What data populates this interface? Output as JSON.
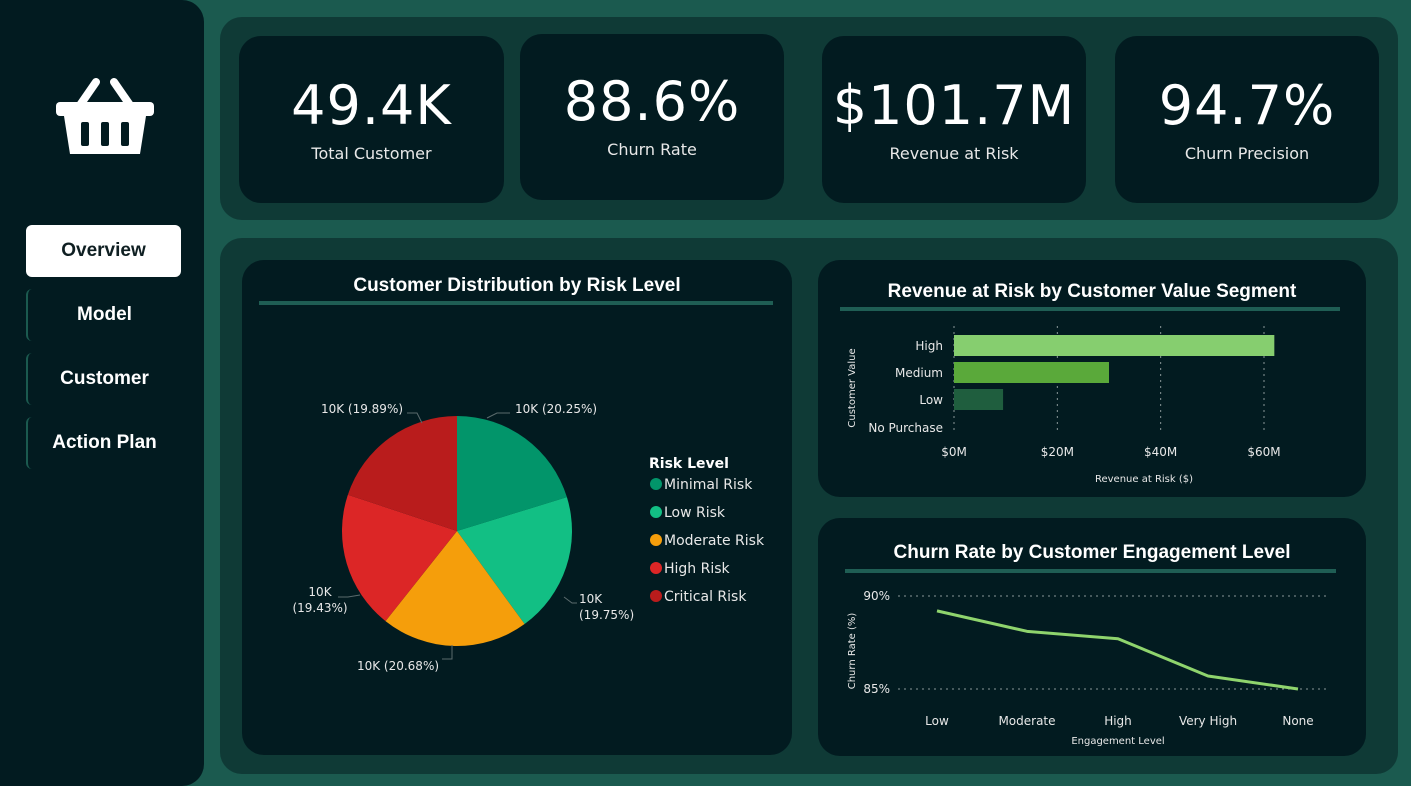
{
  "nav": {
    "items": [
      {
        "label": "Overview",
        "active": true
      },
      {
        "label": "Model",
        "active": false
      },
      {
        "label": "Customer",
        "active": false
      },
      {
        "label": "Action Plan",
        "active": false
      }
    ]
  },
  "kpis": [
    {
      "value": "49.4K",
      "label": "Total Customer"
    },
    {
      "value": "88.6%",
      "label": "Churn Rate"
    },
    {
      "value": "$101.7M",
      "label": "Revenue at Risk"
    },
    {
      "value": "94.7%",
      "label": "Churn Precision"
    }
  ],
  "pie": {
    "title": "Customer Distribution by Risk Level",
    "legend_title": "Risk Level",
    "slice_labels": [
      "10K (20.25%)",
      "10K (19.75%)",
      "10K (20.68%)",
      "10K (19.43%)",
      "10K (19.89%)"
    ]
  },
  "bar": {
    "title": "Revenue at Risk by Customer Value Segment"
  },
  "line": {
    "title": "Churn Rate by Customer Engagement Level"
  },
  "colors": {
    "background": "#1b5a4f",
    "panel": "#0f3a36",
    "card": "#021b20",
    "minimal_risk": "#02956a",
    "low_risk": "#12bf84",
    "moderate_risk": "#f59e0b",
    "high_risk": "#dc2626",
    "critical_risk": "#b91c1c",
    "bar_high": "#86ce6f",
    "bar_medium": "#5aa93a",
    "bar_low": "#1f5e3e",
    "line": "#8fd46d"
  },
  "chart_data": [
    {
      "type": "pie",
      "title": "Customer Distribution by Risk Level",
      "legend_title": "Risk Level",
      "categories": [
        "Minimal Risk",
        "Low Risk",
        "Moderate Risk",
        "High Risk",
        "Critical Risk"
      ],
      "values": [
        20.25,
        19.75,
        20.68,
        19.43,
        19.89
      ],
      "value_unit": "%",
      "colors": [
        "#02956a",
        "#12bf84",
        "#f59e0b",
        "#dc2626",
        "#b91c1c"
      ],
      "legend": "right"
    },
    {
      "type": "bar",
      "orientation": "horizontal",
      "title": "Revenue at Risk by Customer Value Segment",
      "xlabel": "Revenue at Risk ($)",
      "ylabel": "Customer Value",
      "categories": [
        "High",
        "Medium",
        "Low",
        "No Purchase"
      ],
      "values": [
        62,
        30,
        9.5,
        0
      ],
      "value_unit": "$M",
      "xlim": [
        0,
        60
      ],
      "x_ticks": [
        "$0M",
        "$20M",
        "$40M",
        "$60M"
      ],
      "colors": [
        "#86ce6f",
        "#5aa93a",
        "#1f5e3e",
        "#1f5e3e"
      ],
      "grid": true
    },
    {
      "type": "line",
      "title": "Churn Rate by Customer Engagement Level",
      "xlabel": "Engagement Level",
      "ylabel": "Churn Rate (%)",
      "categories": [
        "Low",
        "Moderate",
        "High",
        "Very High",
        "None"
      ],
      "values": [
        89.2,
        88.1,
        87.7,
        85.7,
        85.0
      ],
      "ylim": [
        85,
        90
      ],
      "y_ticks": [
        "85%",
        "90%"
      ],
      "grid": true
    }
  ]
}
